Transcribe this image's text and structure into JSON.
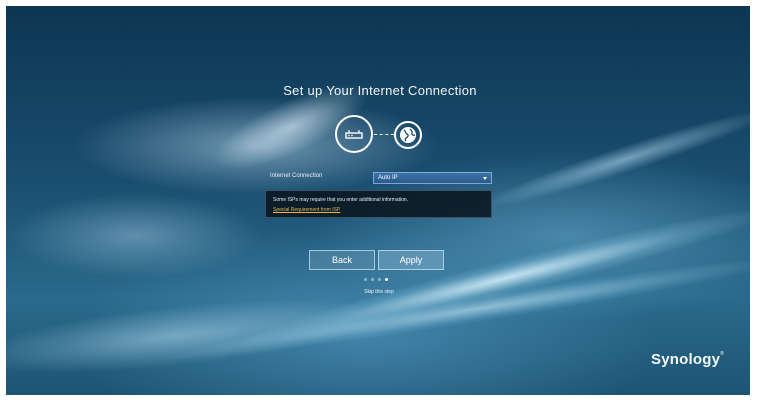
{
  "page": {
    "title": "Set up Your Internet Connection"
  },
  "form": {
    "connection_label": "Internet Connection",
    "connection_selected": "Auto IP",
    "info_text": "Some ISPs may require that you enter additional information.",
    "info_link": "Special Requirement from ISP"
  },
  "buttons": {
    "back_label": "Back",
    "apply_label": "Apply"
  },
  "steps": {
    "total": 4,
    "current": 4
  },
  "footer": {
    "skip_label": "Skip this step",
    "logo_text": "Synology",
    "logo_mark": "®"
  },
  "icons": {
    "router": "router-icon",
    "globe": "globe-icon",
    "dropdown": "chevron-down-icon"
  },
  "colors": {
    "background_dark": "#0d3652",
    "link": "#e6b84a",
    "select_bg": "#3d73a8"
  }
}
